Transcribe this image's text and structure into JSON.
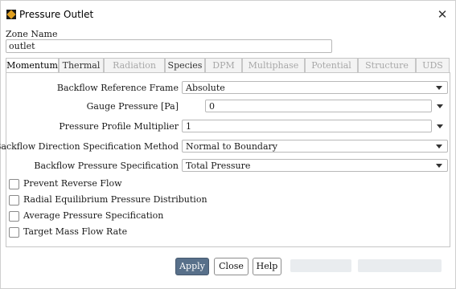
{
  "window": {
    "title": "Pressure Outlet"
  },
  "zone": {
    "label": "Zone Name",
    "value": "outlet"
  },
  "tabs": [
    {
      "label": "Momentum",
      "active": true,
      "enabled": true
    },
    {
      "label": "Thermal",
      "active": false,
      "enabled": true
    },
    {
      "label": "Radiation",
      "active": false,
      "enabled": false
    },
    {
      "label": "Species",
      "active": false,
      "enabled": true
    },
    {
      "label": "DPM",
      "active": false,
      "enabled": false
    },
    {
      "label": "Multiphase",
      "active": false,
      "enabled": false
    },
    {
      "label": "Potential",
      "active": false,
      "enabled": false
    },
    {
      "label": "Structure",
      "active": false,
      "enabled": false
    },
    {
      "label": "UDS",
      "active": false,
      "enabled": false
    }
  ],
  "momentum": {
    "backflow_ref_frame": {
      "label": "Backflow Reference Frame",
      "value": "Absolute"
    },
    "gauge_pressure": {
      "label": "Gauge Pressure",
      "unit": "[Pa]",
      "value": "0"
    },
    "profile_multiplier": {
      "label": "Pressure Profile Multiplier",
      "value": "1"
    },
    "backflow_direction": {
      "label": "Backflow Direction Specification Method",
      "value": "Normal to Boundary"
    },
    "backflow_pressure": {
      "label": "Backflow Pressure Specification",
      "value": "Total Pressure"
    },
    "checkboxes": [
      {
        "label": "Prevent Reverse Flow",
        "checked": false
      },
      {
        "label": "Radial Equilibrium Pressure Distribution",
        "checked": false
      },
      {
        "label": "Average Pressure Specification",
        "checked": false
      },
      {
        "label": "Target Mass Flow Rate",
        "checked": false
      }
    ]
  },
  "buttons": {
    "apply": "Apply",
    "close": "Close",
    "help": "Help"
  },
  "colors": {
    "apply_bg": "#58708a"
  }
}
